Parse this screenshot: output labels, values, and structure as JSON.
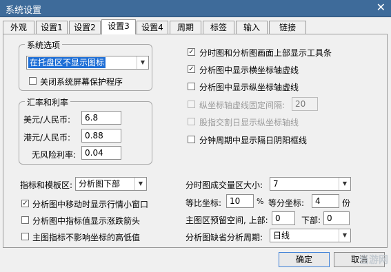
{
  "window": {
    "title": "系统设置",
    "close_glyph": "✕"
  },
  "tabs": [
    "外观",
    "设置1",
    "设置2",
    "设置3",
    "设置4",
    "周期",
    "标签",
    "输入",
    "链接"
  ],
  "active_tab": "设置3",
  "system_options": {
    "title": "系统选项",
    "tray_select": "在托盘区不显示图标",
    "close_screensaver": {
      "label": "关闭系统屏幕保护程序",
      "checked": false
    }
  },
  "exchange": {
    "title": "汇率和利率",
    "usd_label": "美元/人民币:",
    "usd_value": "6.8",
    "hkd_label": "港元/人民币:",
    "hkd_value": "0.88",
    "riskfree_label": "无风险利率:",
    "riskfree_value": "0.04"
  },
  "right_options": {
    "toolbar": {
      "label": "分时图和分析图画面上部显示工具条",
      "checked": true
    },
    "horiz_grid": {
      "label": "分析图中显示横坐标轴虚线",
      "checked": true
    },
    "vert_grid": {
      "label": "分析图中显示纵坐标轴虚线",
      "checked": false
    },
    "fixed_interval": {
      "label": "纵坐标轴虚线固定间隔:",
      "value": "20",
      "checked": false
    },
    "ex_date": {
      "label": "股指交割日显示纵坐标轴线",
      "checked": false
    },
    "minute_shade": {
      "label": "分钟周期中显示隔日阴阳框线",
      "checked": false
    }
  },
  "lower": {
    "indicator_label": "指标和模板区:",
    "indicator_select": "分析图下部",
    "opt_popup": {
      "label": "分析图中移动时显示行情小窗口",
      "checked": true
    },
    "opt_arrow": {
      "label": "分析图中指标值显示涨跌箭头",
      "checked": false
    },
    "opt_highlow": {
      "label": "主图指标不影响坐标的高低值",
      "checked": false
    },
    "volume_label": "分时图成交量区大小:",
    "volume_select": "7",
    "ratio_label": "等比坐标:",
    "ratio_value": "10",
    "ratio_unit": "%",
    "equal_label": "等分坐标:",
    "equal_value": "4",
    "equal_unit": "份",
    "reserve_label": "主图区预留空间, 上部:",
    "reserve_top": "0",
    "reserve_bottom_label": "下部:",
    "reserve_bottom": "0",
    "period_label": "分析图缺省分析周期:",
    "period_select": "日线"
  },
  "buttons": {
    "ok": "确定",
    "cancel": "取消"
  },
  "watermark": "当游网"
}
